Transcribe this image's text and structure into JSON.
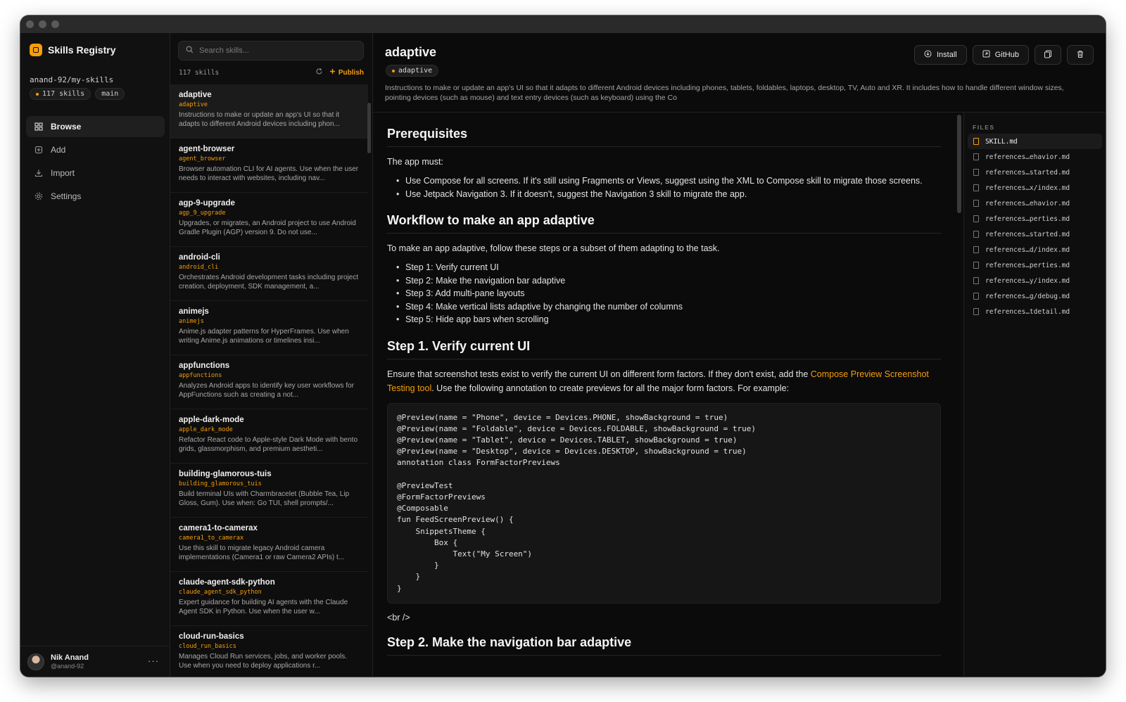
{
  "app": {
    "title": "Skills Registry",
    "repo": "anand-92/my-skills",
    "skill_count_badge": "117 skills",
    "branch": "main"
  },
  "nav": [
    {
      "label": "Browse",
      "icon": "grid-icon"
    },
    {
      "label": "Add",
      "icon": "plus-icon"
    },
    {
      "label": "Import",
      "icon": "import-icon"
    },
    {
      "label": "Settings",
      "icon": "gear-icon"
    }
  ],
  "user": {
    "name": "Nik Anand",
    "handle": "@anand-92"
  },
  "list": {
    "search_placeholder": "Search skills...",
    "count": "117 skills",
    "publish_label": "Publish",
    "items": [
      {
        "name": "adaptive",
        "id": "adaptive",
        "desc": "Instructions to make or update an app's UI so that it adapts to different Android devices including phon..."
      },
      {
        "name": "agent-browser",
        "id": "agent_browser",
        "desc": "Browser automation CLI for AI agents. Use when the user needs to interact with websites, including nav..."
      },
      {
        "name": "agp-9-upgrade",
        "id": "agp_9_upgrade",
        "desc": "Upgrades, or migrates, an Android project to use Android Gradle Plugin (AGP) version 9. Do not use..."
      },
      {
        "name": "android-cli",
        "id": "android_cli",
        "desc": "Orchestrates Android development tasks including project creation, deployment, SDK management, a..."
      },
      {
        "name": "animejs",
        "id": "animejs",
        "desc": "Anime.js adapter patterns for HyperFrames. Use when writing Anime.js animations or timelines insi..."
      },
      {
        "name": "appfunctions",
        "id": "appfunctions",
        "desc": "Analyzes Android apps to identify key user workflows for AppFunctions such as creating a not..."
      },
      {
        "name": "apple-dark-mode",
        "id": "apple_dark_mode",
        "desc": "Refactor React code to Apple-style Dark Mode with bento grids, glassmorphism, and premium aestheti..."
      },
      {
        "name": "building-glamorous-tuis",
        "id": "building_glamorous_tuis",
        "desc": "Build terminal UIs with Charmbracelet (Bubble Tea, Lip Gloss, Gum). Use when: Go TUI, shell prompts/..."
      },
      {
        "name": "camera1-to-camerax",
        "id": "camera1_to_camerax",
        "desc": "Use this skill to migrate legacy Android camera implementations (Camera1 or raw Camera2 APIs) t..."
      },
      {
        "name": "claude-agent-sdk-python",
        "id": "claude_agent_sdk_python",
        "desc": "Expert guidance for building AI agents with the Claude Agent SDK in Python. Use when the user w..."
      },
      {
        "name": "cloud-run-basics",
        "id": "cloud_run_basics",
        "desc": "Manages Cloud Run services, jobs, and worker pools. Use when you need to deploy applications r..."
      }
    ]
  },
  "detail": {
    "title": "adaptive",
    "tag": "adaptive",
    "description": "Instructions to make or update an app's UI so that it adapts to different Android devices including phones, tablets, foldables, laptops, desktop, TV, Auto and XR. It includes how to handle different window sizes, pointing devices (such as mouse) and text entry devices (such as keyboard) using the Co",
    "actions": {
      "install": "Install",
      "github": "GitHub"
    }
  },
  "doc": {
    "h_prereq": "Prerequisites",
    "p_must": "The app must:",
    "prereq_items": [
      "Use Compose for all screens. If it's still using Fragments or Views, suggest using the XML to Compose skill to migrate those screens.",
      "Use Jetpack Navigation 3. If it doesn't, suggest the Navigation 3 skill to migrate the app."
    ],
    "h_workflow": "Workflow to make an app adaptive",
    "p_workflow": "To make an app adaptive, follow these steps or a subset of them adapting to the task.",
    "steps": [
      "Step 1: Verify current UI",
      "Step 2: Make the navigation bar adaptive",
      "Step 3: Add multi-pane layouts",
      "Step 4: Make vertical lists adaptive by changing the number of columns",
      "Step 5: Hide app bars when scrolling"
    ],
    "h_step1": "Step 1. Verify current UI",
    "p_step1_a": "Ensure that screenshot tests exist to verify the current UI on different form factors. If they don't exist, add the ",
    "p_step1_link": "Compose Preview Screenshot Testing tool",
    "p_step1_b": ". Use the following annotation to create previews for all the major form factors. For example:",
    "code": "@Preview(name = \"Phone\", device = Devices.PHONE, showBackground = true)\n@Preview(name = \"Foldable\", device = Devices.FOLDABLE, showBackground = true)\n@Preview(name = \"Tablet\", device = Devices.TABLET, showBackground = true)\n@Preview(name = \"Desktop\", device = Devices.DESKTOP, showBackground = true)\nannotation class FormFactorPreviews\n\n@PreviewTest\n@FormFactorPreviews\n@Composable\nfun FeedScreenPreview() {\n    SnippetsTheme {\n        Box {\n            Text(\"My Screen\")\n        }\n    }\n}",
    "br_text": "<br />",
    "h_step2": "Step 2. Make the navigation bar adaptive"
  },
  "files": {
    "label": "FILES",
    "items": [
      "SKILL.md",
      "references…ehavior.md",
      "references…started.md",
      "references…x/index.md",
      "references…ehavior.md",
      "references…perties.md",
      "references…started.md",
      "references…d/index.md",
      "references…perties.md",
      "references…y/index.md",
      "references…g/debug.md",
      "references…tdetail.md"
    ]
  },
  "colors": {
    "accent": "#f59e0b",
    "background": "#0b0b0b",
    "surface": "#111111"
  }
}
